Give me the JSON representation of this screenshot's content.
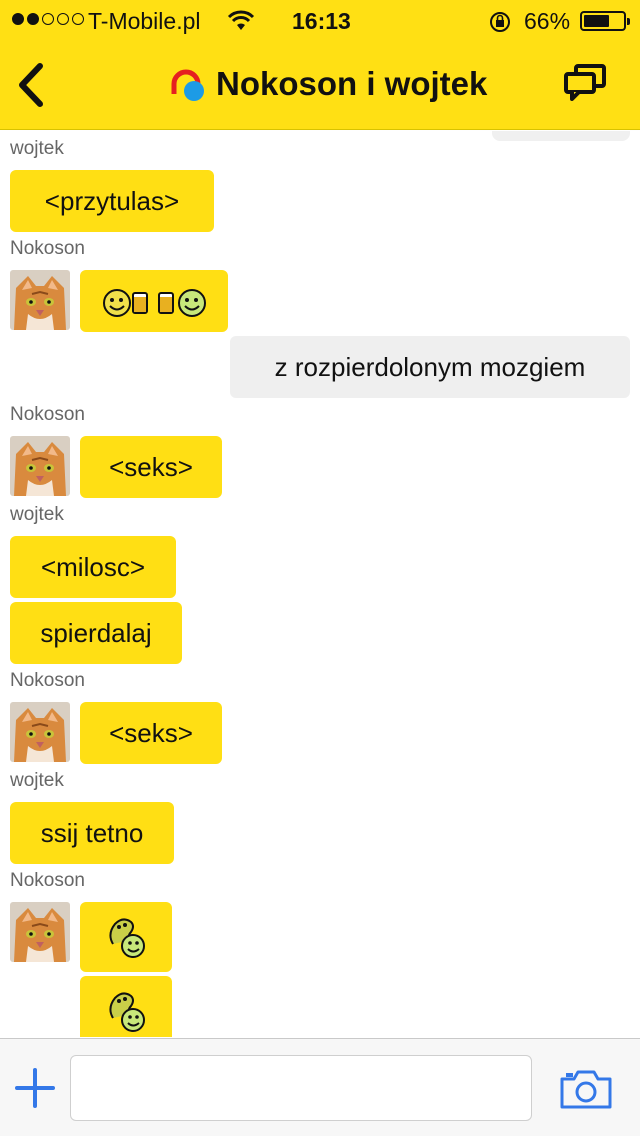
{
  "status_bar": {
    "carrier": "T-Mobile.pl",
    "time": "16:13",
    "battery_percent": "66%",
    "battery_level": 0.66,
    "signal_dots_filled": 2,
    "signal_dots_total": 5
  },
  "header": {
    "title": "Nokoson i wojtek",
    "back_icon": "chevron-left-icon",
    "logo_icon": "chat-logo-icon",
    "chats_icon": "chats-icon"
  },
  "colors": {
    "accent": "#ffe014",
    "bubble_in": "#ffdf14",
    "bubble_out": "#efefef",
    "link_blue": "#3478e8"
  },
  "messages": [
    {
      "sender": "wojtek"
    },
    {
      "text": "<przytulas>"
    },
    {
      "sender": "Nokoson"
    },
    {
      "emoji": "smiley-beer-beer-smiley"
    },
    {
      "text": "z rozpierdolonym mozgiem"
    },
    {
      "sender": "Nokoson"
    },
    {
      "text": "<seks>"
    },
    {
      "sender": "wojtek"
    },
    {
      "text": "<milosc>"
    },
    {
      "text": "spierdalaj"
    },
    {
      "sender": "Nokoson"
    },
    {
      "text": "<seks>"
    },
    {
      "sender": "wojtek"
    },
    {
      "text": "ssij tetno"
    },
    {
      "sender": "Nokoson"
    },
    {
      "emoji": "snake-smiley"
    },
    {
      "emoji": "snake-smiley"
    }
  ],
  "composer": {
    "placeholder": "",
    "value": "",
    "add_icon": "plus-icon",
    "camera_icon": "camera-icon"
  }
}
